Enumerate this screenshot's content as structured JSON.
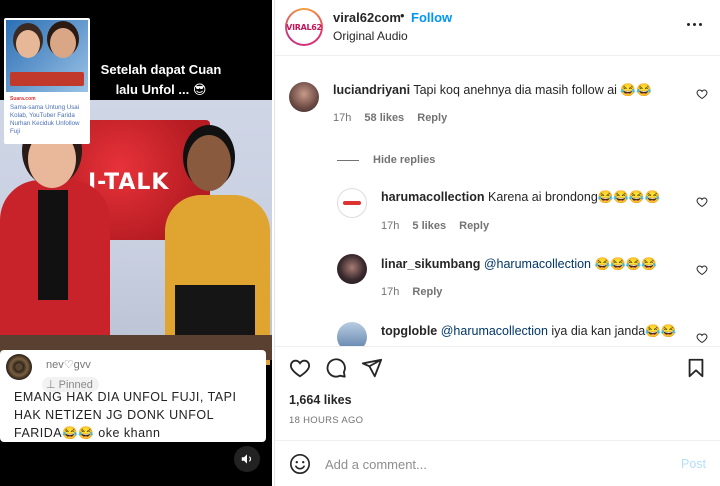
{
  "media": {
    "overlay_title": "Setelah dapat Cuan lalu Unfol ...",
    "overlay_emoji": "😎",
    "thumbnail": {
      "source": "Suara.com",
      "caption": "Sama-sama Untung Usai Kolab, YouTuber Farida Nurhan Keciduk Unfollow Fuji"
    },
    "studio_text": "I-TALK",
    "pinned_comment": {
      "username": "nev♡gvv",
      "pinned_label": "Pinned",
      "text": "EMANG HAK DIA UNFOL FUJI, TAPI HAK NETIZEN JG DONK UNFOL FARIDA😂😂 oke khann"
    }
  },
  "header": {
    "avatar_logo": "VIRAL62",
    "username": "viral62com",
    "dot": "•",
    "follow_label": "Follow",
    "subtitle": "Original Audio"
  },
  "comments": [
    {
      "username": "luciandriyani",
      "text": "Tapi koq anehnya dia masih follow ai 😂😂",
      "time": "17h",
      "likes": "58 likes",
      "reply_label": "Reply",
      "avatar_color": "#6b4a44"
    }
  ],
  "hide_replies_label": "Hide replies",
  "replies": [
    {
      "username": "harumacollection",
      "mention": "",
      "text": "Karena ai brondong😂😂😂😂",
      "time": "17h",
      "likes": "5 likes",
      "reply_label": "Reply",
      "avatar_color": "#ffffff"
    },
    {
      "username": "linar_sikumbang",
      "mention": "@harumacollection",
      "text": "😂😂😂😂",
      "time": "17h",
      "likes": "",
      "reply_label": "Reply",
      "avatar_color": "#3a2a2e"
    },
    {
      "username": "topgloble",
      "mention": "@harumacollection",
      "text": "iya dia kan janda😂😂",
      "time": "",
      "likes": "",
      "reply_label": "",
      "avatar_color": "#5b7ea8"
    }
  ],
  "actions": {
    "like_icon": "heart-icon",
    "comment_icon": "comment-icon",
    "share_icon": "send-icon",
    "save_icon": "bookmark-icon",
    "likes_count": "1,664 likes",
    "time_ago": "18 HOURS AGO"
  },
  "add_comment": {
    "placeholder": "Add a comment...",
    "post_label": "Post"
  },
  "colors": {
    "link_blue": "#0095f6",
    "post_disabled": "#b2dffc",
    "meta_gray": "#737373"
  }
}
